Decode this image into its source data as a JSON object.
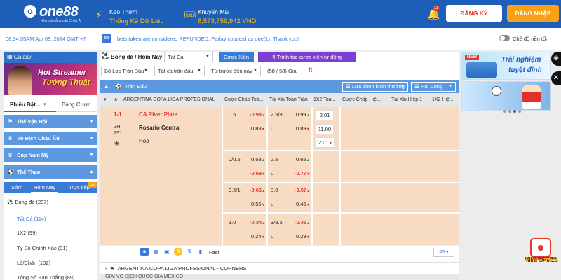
{
  "header": {
    "logo_text": "one88",
    "logo_sub": "Nhà cái đẳng cấp Châu Á",
    "promo1_title": "Kèo Thơm",
    "promo1_value": "Thống Kê Dữ Liệu",
    "promo2_title": "Khuyến Mãi",
    "promo2_value": "8,573,759,942 VND",
    "bell_count": "11",
    "register_label": "ĐĂNG KÝ",
    "login_label": "ĐĂNG NHẬP"
  },
  "notice": {
    "time": "08:34:55AM Apr 08, 2024 GMT +7",
    "text": "bets taken are considered REFUNDED. Parlay counted as one(1). Thank you!",
    "toggle_label": "Chế độ nền tối"
  },
  "sidebar": {
    "galaxy_label": "Galaxy",
    "banner_line1": "Hot Streamer",
    "banner_line2": "Tướng Thuật",
    "slip_tab": "Phiếu Đặt...",
    "history_tab": "Bảng Cược",
    "nav": [
      {
        "label": "Thế Vận Hội"
      },
      {
        "label": "Vô Địch Châu Âu"
      },
      {
        "label": "Cúp Nam Mỹ"
      },
      {
        "label": "Thể Thao"
      }
    ],
    "sub_tabs": [
      "Sớm",
      "Hôm Nay",
      "Trực tiếp"
    ],
    "live_badge": "129",
    "sport": "Bóng đá (207)",
    "markets": [
      "Tất Cả (114)",
      "1X2 (99)",
      "Tỷ Số Chính Xác (91)",
      "Lẻ/Chẵn (102)",
      "Tổng Số Bàn Thắng (89)"
    ]
  },
  "main": {
    "title": "Bóng đá / Hôm Nay",
    "dd_all": "Tất Cả",
    "btn_parlay": "Cược Xiên",
    "btn_create": "Trình tạo cược xiên tự động",
    "f_league": "Bộ Lọc Trận Đấu",
    "f_all_matches": "Tất cả trận đấu",
    "f_sort": "Từ trước đến nay",
    "f_count": "(58 / 58) Giải",
    "section": "Trận Đấu",
    "select_view": "Lựa chọn bình thường",
    "select_lines": "Hai Dòng",
    "cols": [
      "ARGENTINA COPA LIGA PROFESIONAL",
      "Cược Chấp Toà...",
      "Tài Xỉu Toàn Trận",
      "1X2 Toà...",
      "Cược Chấp Hiệ...",
      "Tài Xỉu Hiệp 1",
      "1X2 Hiệ..."
    ],
    "match": {
      "score": "1-1",
      "time": "2H\n29'",
      "home": "CA River Plate",
      "away": "Rosario Central",
      "draw": "Hòa",
      "rows": [
        {
          "h": "0.5",
          "h1": "-0.98",
          "h2": "0.88",
          "ou": "2.5/3",
          "o1": "0.99",
          "o2": "0.89",
          "u": "u"
        },
        {
          "h": "0/0.5",
          "h1": "0.58",
          "h2": "-0.68",
          "ou": "2.5",
          "o1": "0.65",
          "o2": "-0.77",
          "u": "u"
        },
        {
          "h": "0.5/1",
          "h1": "-0.65",
          "h2": "0.55",
          "ou": "3.0",
          "o1": "-0.57",
          "o2": "0.45",
          "u": "u"
        },
        {
          "h": "1.0",
          "h1": "-0.34",
          "h2": "0.24",
          "ou": "3/3.5",
          "o1": "-0.41",
          "o2": "0.29",
          "u": "u"
        }
      ],
      "x12": [
        "2.01",
        "11.00",
        "2.01"
      ],
      "fast": "Fast",
      "more": "43"
    },
    "league2": "ARGENTINA COPA LIGA PROFESIONAL - CORNERS",
    "league3": "GIẢI VÔ ĐỊCH QUỐC GIA MEXICO"
  },
  "right": {
    "promo_new": "NEW",
    "promo_line1": "Trải nghiệm",
    "promo_line2": "tuyệt đỉnh",
    "minigames": "MINI GAMES"
  },
  "colors": {
    "brand": "#1d5fb8",
    "accent": "#f7a11b",
    "odds_negative": "#e8332a",
    "row_bg": "#f7dcc3"
  }
}
